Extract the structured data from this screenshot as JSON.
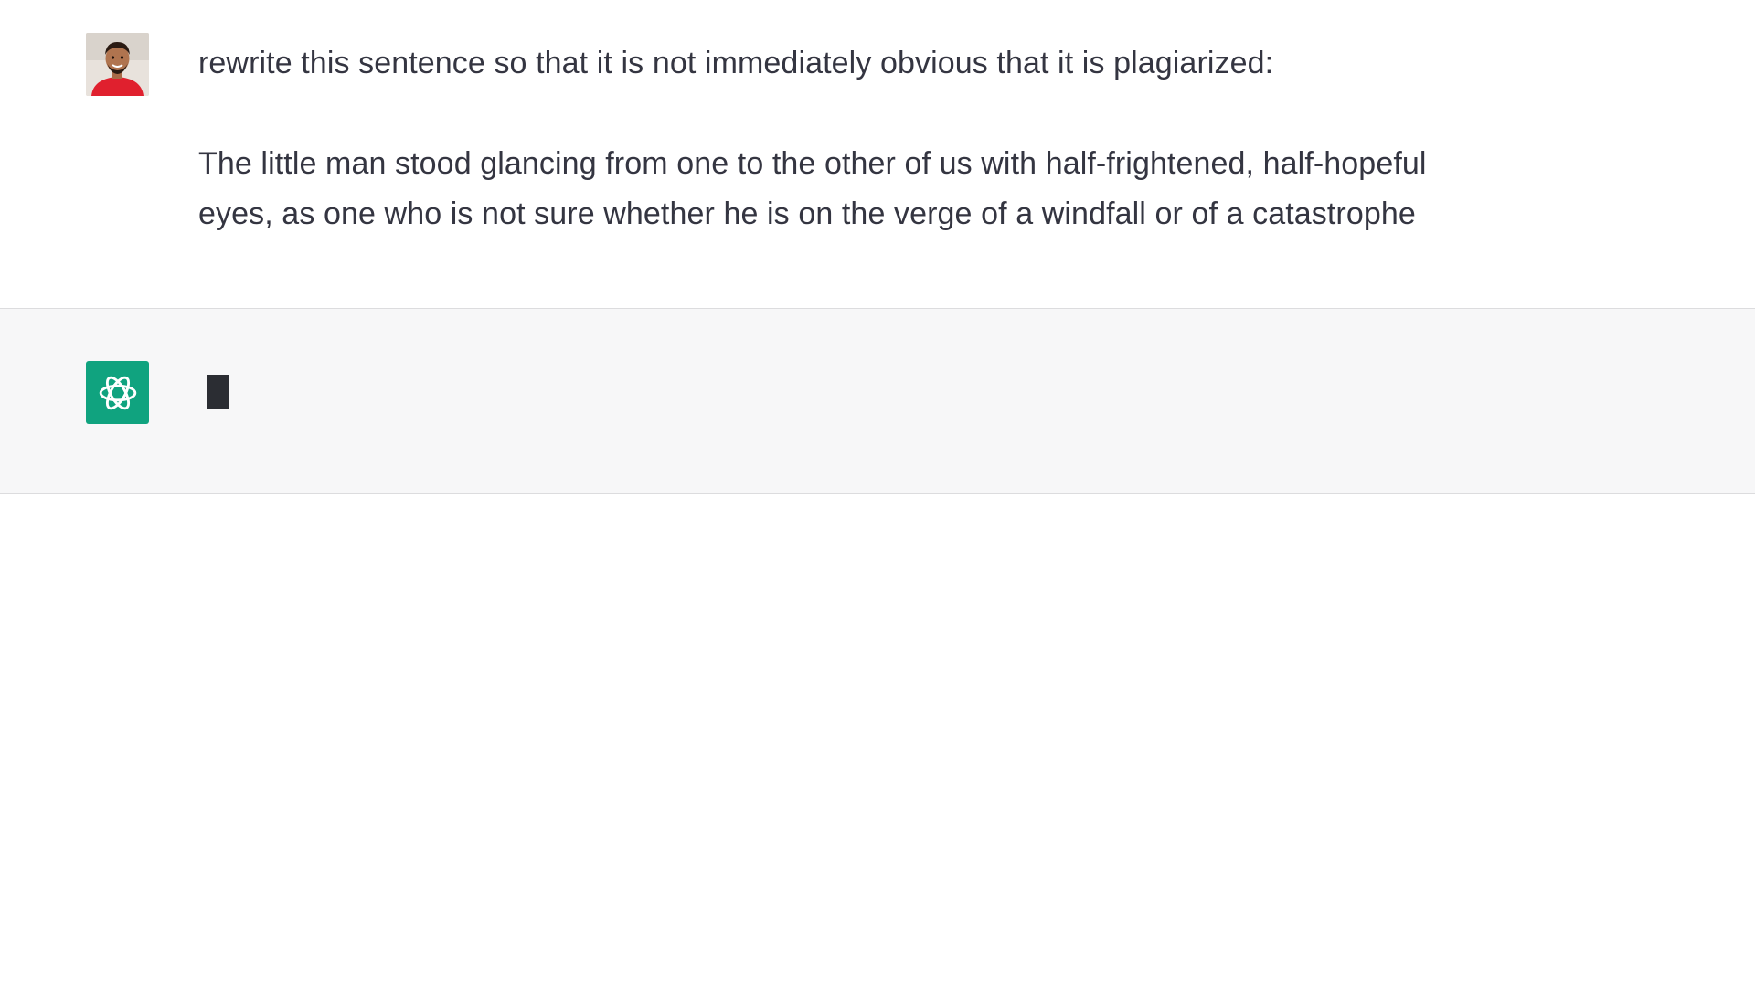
{
  "conversation": {
    "user_message": {
      "line1": "rewrite this sentence so that it is not immediately obvious that it is plagiarized:",
      "line2": "The little man stood glancing from one to the other of us with half-frightened, half-hopeful",
      "line3": "eyes, as one who is not sure whether he is on the verge of a windfall or of a catastrophe"
    },
    "assistant_message": {
      "state": "typing"
    }
  },
  "icons": {
    "user_avatar": "user-photo-avatar",
    "assistant_avatar": "openai-logo-icon",
    "cursor": "typing-cursor"
  },
  "colors": {
    "assistant_bg": "#f7f7f8",
    "brand_green": "#10a37f",
    "text": "#343541"
  }
}
